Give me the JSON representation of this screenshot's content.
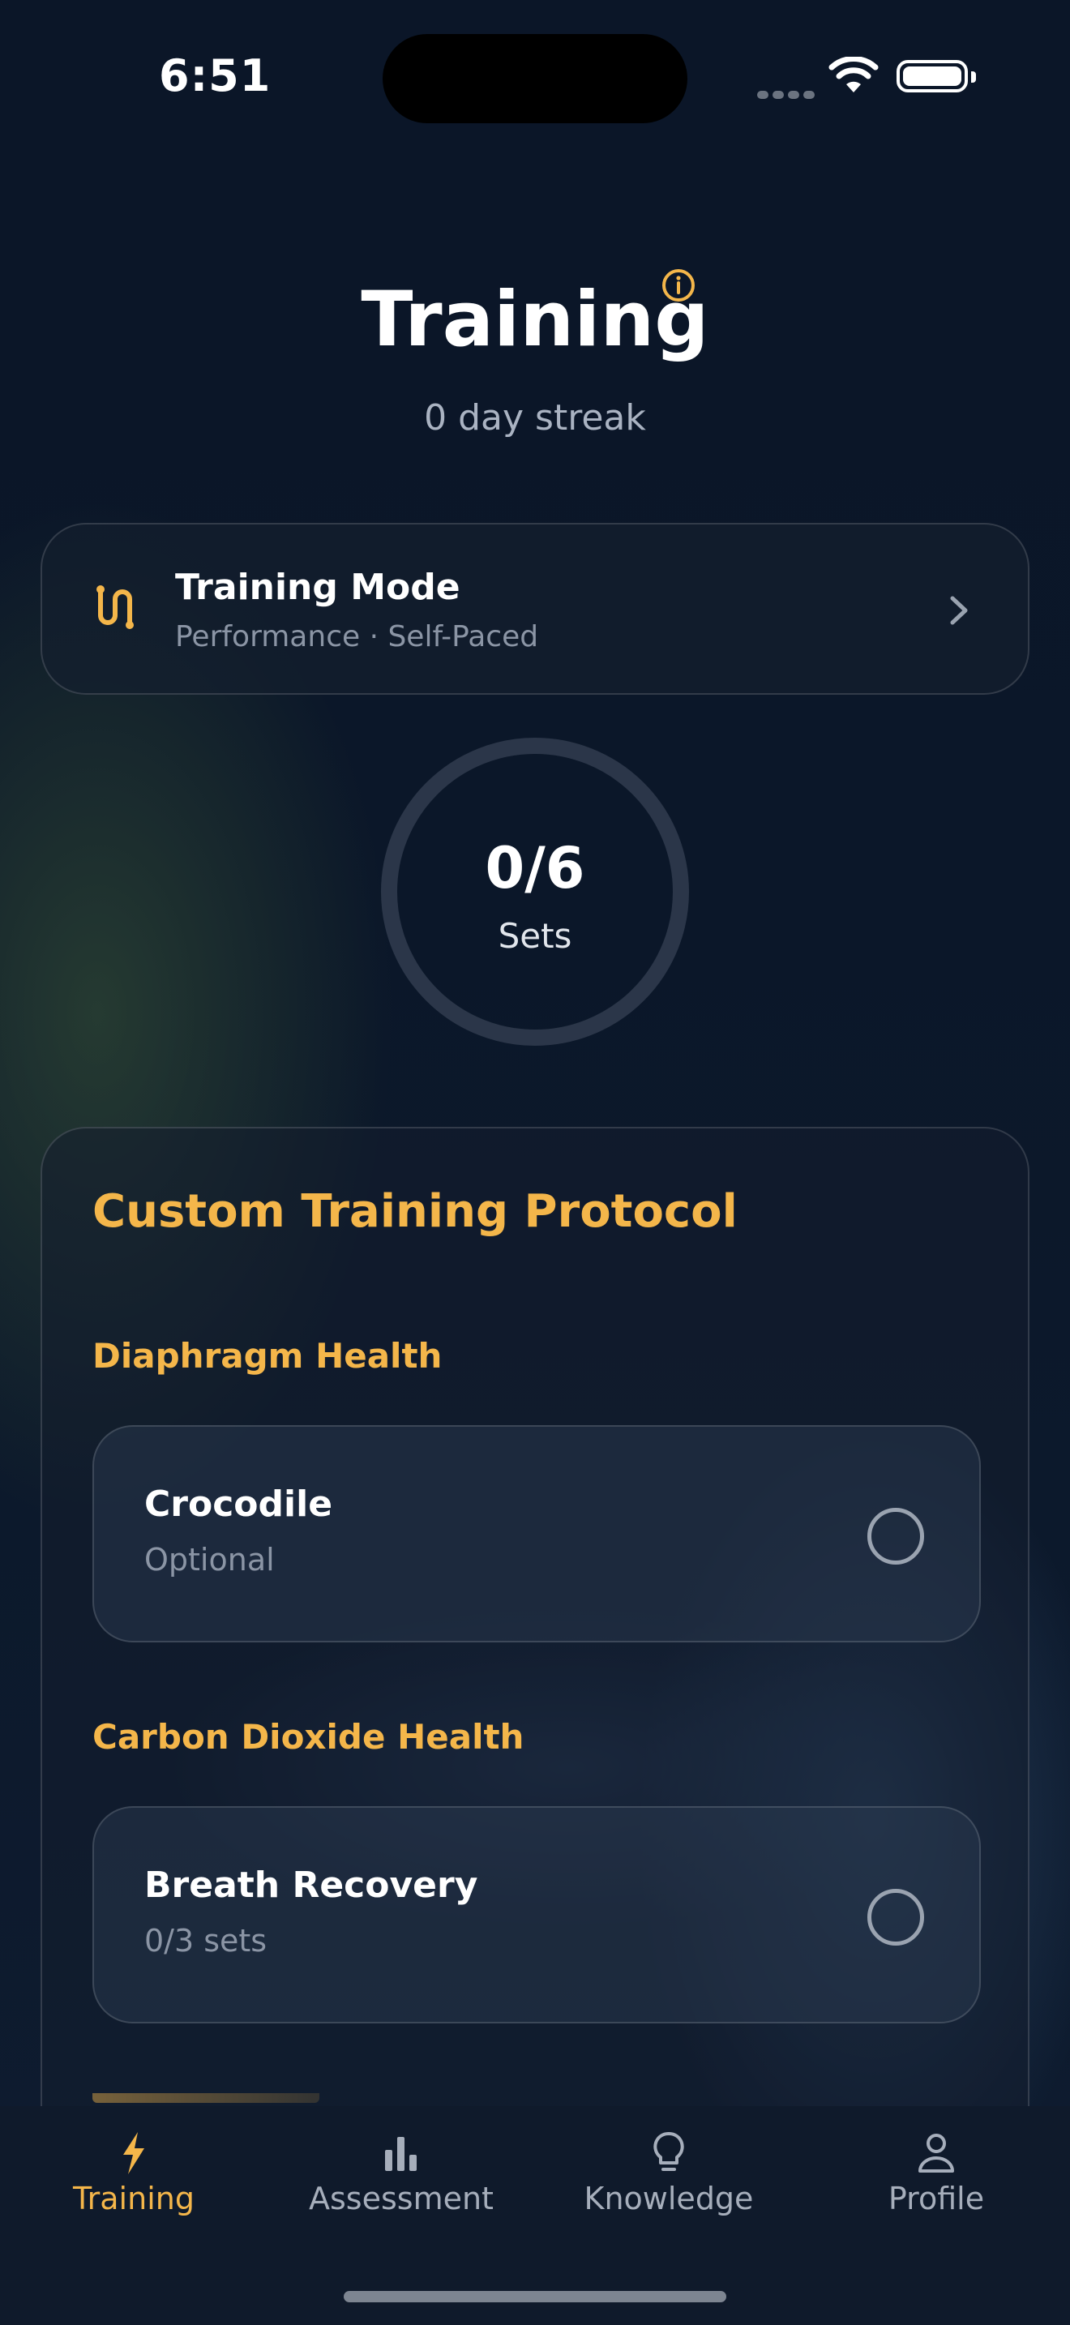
{
  "status_bar": {
    "time": "6:51"
  },
  "header": {
    "title": "Training",
    "streak": "0 day streak"
  },
  "training_mode": {
    "title": "Training Mode",
    "subtitle": "Performance · Self-Paced"
  },
  "progress": {
    "value": "0/6",
    "label": "Sets",
    "completed": 0,
    "total": 6
  },
  "protocol": {
    "title": "Custom Training Protocol",
    "sections": [
      {
        "label": "Diaphragm Health",
        "exercise": {
          "name": "Crocodile",
          "detail": "Optional",
          "done": false
        }
      },
      {
        "label": "Carbon Dioxide Health",
        "exercise": {
          "name": "Breath Recovery",
          "detail": "0/3 sets",
          "done": false
        }
      }
    ]
  },
  "tabs": [
    {
      "label": "Training",
      "icon": "bolt-icon",
      "active": true
    },
    {
      "label": "Assessment",
      "icon": "bar-chart-icon",
      "active": false
    },
    {
      "label": "Knowledge",
      "icon": "lightbulb-icon",
      "active": false
    },
    {
      "label": "Profile",
      "icon": "person-icon",
      "active": false
    }
  ],
  "colors": {
    "accent": "#f4b64a",
    "background": "#0a1526",
    "muted": "#8b95a5"
  }
}
